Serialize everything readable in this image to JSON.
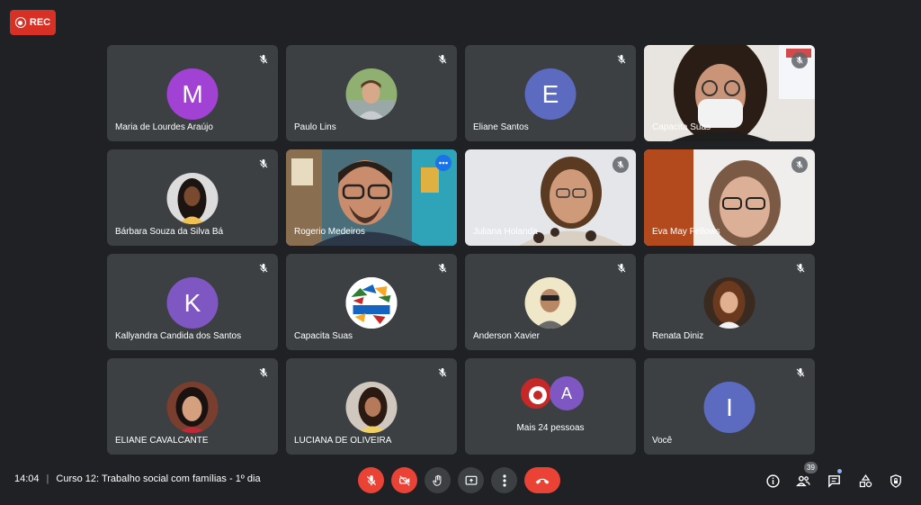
{
  "rec": {
    "label": "REC"
  },
  "tiles": [
    {
      "name": "Maria de Lourdes Araújo",
      "initial": "M",
      "avatar_color": "#a142d4"
    },
    {
      "name": "Paulo Lins"
    },
    {
      "name": "Eliane Santos",
      "initial": "E",
      "avatar_color": "#5c6bc0"
    },
    {
      "name": "Capacita Suas"
    },
    {
      "name": "Bárbara Souza da Silva Bá"
    },
    {
      "name": "Rogerio Medeiros"
    },
    {
      "name": "Juliana Holanda"
    },
    {
      "name": "Eva May Fellows"
    },
    {
      "name": "Kallyandra Candida dos Santos",
      "initial": "K",
      "avatar_color": "#7e57c2"
    },
    {
      "name": "Capacita Suas",
      "logo_text": "Capacita SUAS PE"
    },
    {
      "name": "Anderson Xavier"
    },
    {
      "name": "Renata Diniz"
    },
    {
      "name": "ELIANE CAVALCANTE"
    },
    {
      "name": "LUCIANA DE OLIVEIRA"
    },
    {
      "more_label": "Mais 24 pessoas",
      "initial": "A",
      "avatar_color": "#7e57c2"
    },
    {
      "name": "Você",
      "initial": "I",
      "avatar_color": "#5c6bc0"
    }
  ],
  "bottom": {
    "time": "14:04",
    "separator": "|",
    "meeting_title": "Curso 12: Trabalho social com famílias - 1º dia",
    "participants_count": "39"
  },
  "colors": {
    "background": "#202124",
    "tile": "#3c4043",
    "red": "#ea4335",
    "active_outline": "#8ab4f8"
  }
}
